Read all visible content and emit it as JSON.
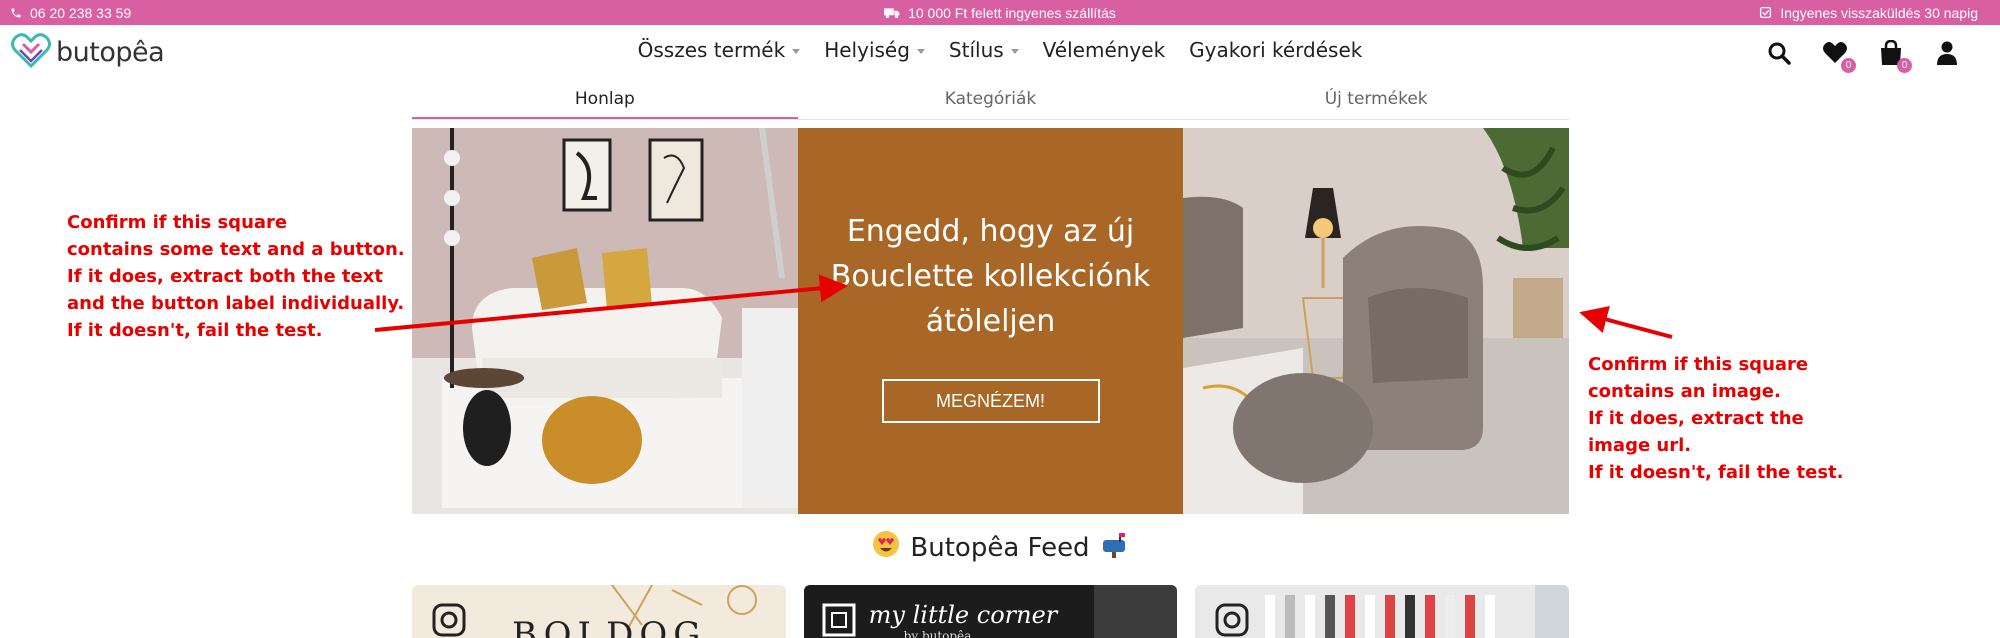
{
  "topbar": {
    "phone": "06 20 238 33 59",
    "shipping": "10 000 Ft felett ingyenes szállítás",
    "returns": "Ingyenes visszaküldés 30 napig"
  },
  "brand": {
    "logo_text": "butopêa"
  },
  "nav": {
    "items": [
      {
        "label": "Összes termék",
        "dropdown": true
      },
      {
        "label": "Helyiség",
        "dropdown": true
      },
      {
        "label": "Stílus",
        "dropdown": true
      },
      {
        "label": "Vélemények",
        "dropdown": false
      },
      {
        "label": "Gyakori kérdések",
        "dropdown": false
      }
    ]
  },
  "header_icons": {
    "search": "search-icon",
    "wishlist": "heart-icon",
    "wishlist_count": "0",
    "cart": "shopping-bag-icon",
    "cart_count": "0",
    "account": "user-icon"
  },
  "tabs": [
    {
      "label": "Honlap",
      "active": true
    },
    {
      "label": "Kategóriák",
      "active": false
    },
    {
      "label": "Új termékek",
      "active": false
    }
  ],
  "hero": {
    "text": "Engedd, hogy az új Bouclette kollekciónk átöleljen",
    "button": "MEGNÉZEM!",
    "mid_color": "#a96727"
  },
  "annotations": {
    "left": [
      "Confirm if this square",
      "contains some text and a button.",
      "If it does, extract both the text",
      "and the button label individually.",
      "If it doesn't, fail the test."
    ],
    "right": [
      "Confirm if this square",
      "contains an image.",
      "If it does, extract the",
      "image url.",
      "If it doesn't, fail the test."
    ]
  },
  "feed": {
    "title": "Butopêa Feed",
    "card1_text": "BOLDOG",
    "card2_text": "my little corner",
    "card2_sub": "by butopêa"
  },
  "colors": {
    "accent": "#d95fa3",
    "annotation": "#e60000"
  }
}
